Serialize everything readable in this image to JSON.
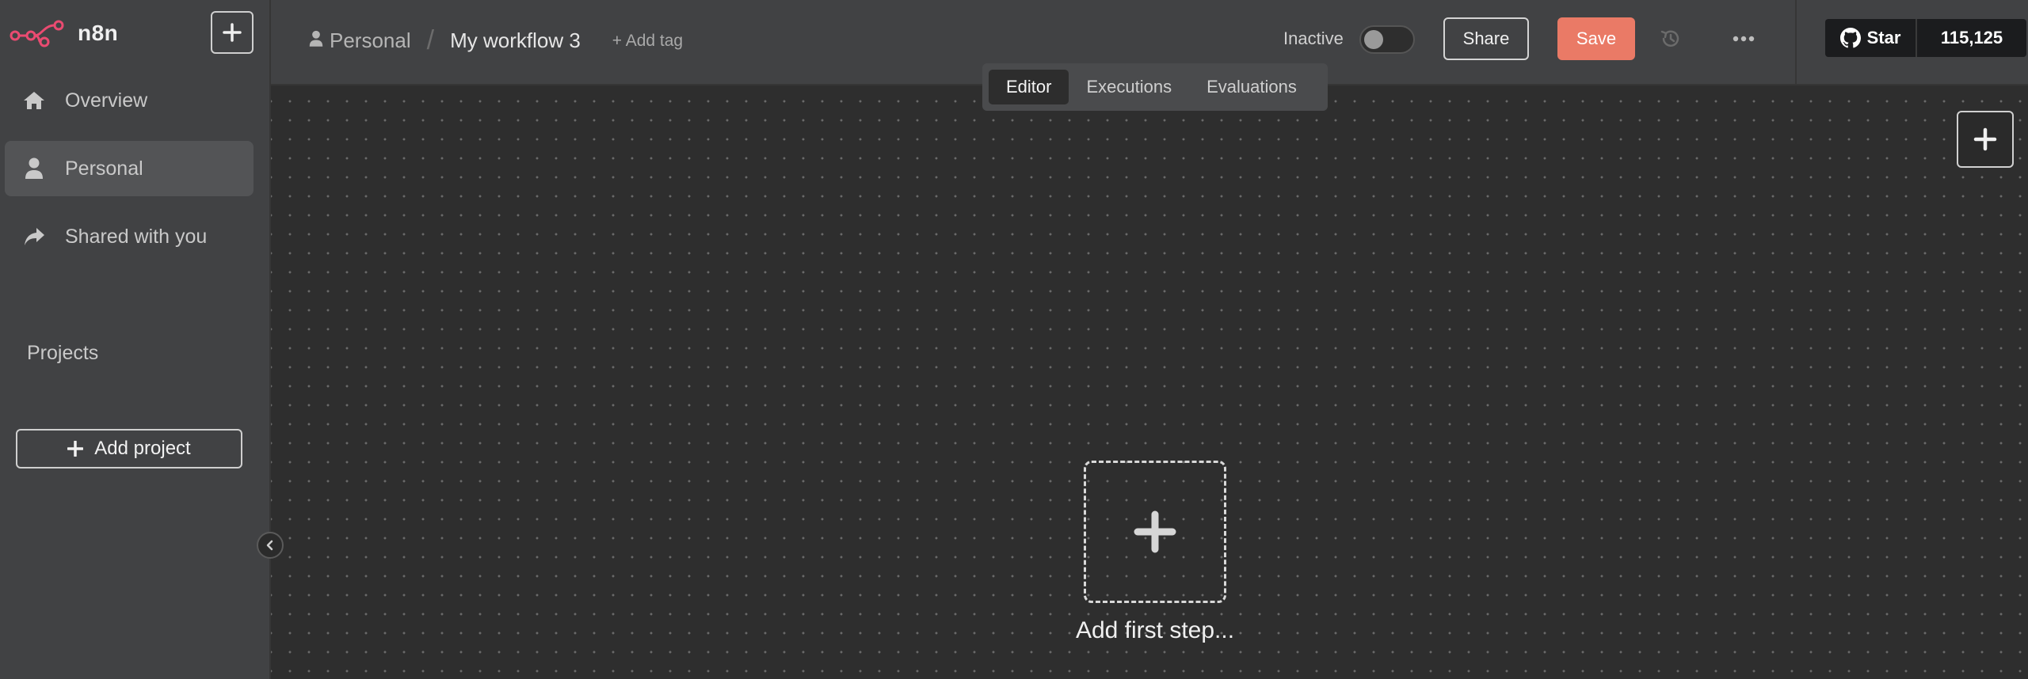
{
  "sidebar": {
    "logo_text": "n8n",
    "items": [
      {
        "label": "Overview",
        "icon": "home-icon"
      },
      {
        "label": "Personal",
        "icon": "user-icon",
        "active": true
      },
      {
        "label": "Shared with you",
        "icon": "share-icon"
      }
    ],
    "projects_title": "Projects",
    "add_project_label": "Add project"
  },
  "header": {
    "breadcrumb_project": "Personal",
    "breadcrumb_separator": "/",
    "workflow_name": "My workflow 3",
    "add_tag_label": "+ Add tag",
    "status_label": "Inactive",
    "active": false,
    "share_label": "Share",
    "save_label": "Save",
    "github": {
      "star_label": "Star",
      "count": "115,125"
    }
  },
  "tabs": [
    {
      "label": "Editor",
      "active": true
    },
    {
      "label": "Executions",
      "active": false
    },
    {
      "label": "Evaluations",
      "active": false
    }
  ],
  "canvas": {
    "first_step_label": "Add first step..."
  },
  "colors": {
    "accent": "#ea7a66",
    "logo": "#ea4b71",
    "sidebar_bg": "#414244",
    "canvas_bg": "#2e2e2e"
  }
}
